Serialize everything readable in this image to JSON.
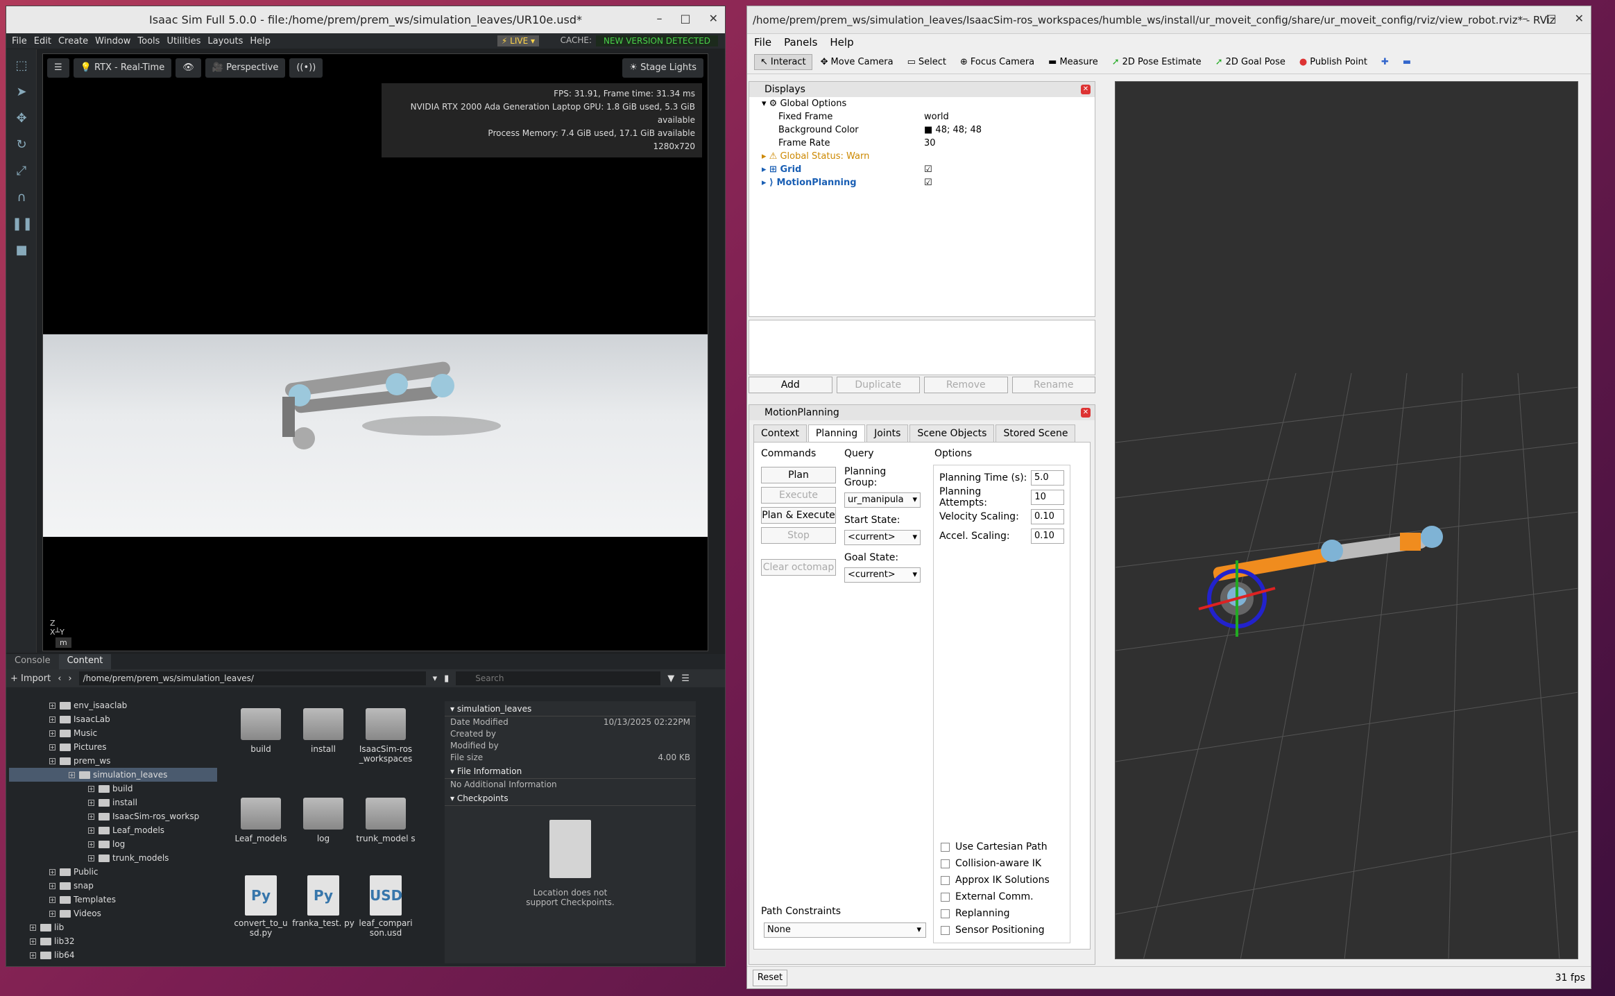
{
  "isaac": {
    "title": "Isaac Sim Full 5.0.0 - file:/home/prem/prem_ws/simulation_leaves/UR10e.usd*",
    "menu": [
      "File",
      "Edit",
      "Create",
      "Window",
      "Tools",
      "Utilities",
      "Layouts",
      "Help"
    ],
    "live": "LIVE",
    "cache": "CACHE:",
    "new_version": "NEW VERSION DETECTED",
    "viewport": {
      "rtx": "RTX - Real-Time",
      "perspective": "Perspective",
      "stage_lights": "Stage Lights",
      "stats": [
        "FPS: 31.91, Frame time: 31.34 ms",
        "NVIDIA RTX 2000 Ada Generation Laptop GPU: 1.8 GiB used, 5.3 GiB available",
        "Process Memory: 7.4 GiB used, 17.1 GiB available",
        "1280x720"
      ],
      "unit": "m",
      "axis_z": "Z",
      "axis_x": "X",
      "axis_y": "Y"
    },
    "bottom": {
      "tab_console": "Console",
      "tab_content": "Content",
      "import": "Import",
      "path": "/home/prem/prem_ws/simulation_leaves/",
      "search": "Search",
      "tree": [
        {
          "label": "env_isaaclab",
          "indent": 1
        },
        {
          "label": "IsaacLab",
          "indent": 1
        },
        {
          "label": "Music",
          "indent": 1
        },
        {
          "label": "Pictures",
          "indent": 1
        },
        {
          "label": "prem_ws",
          "indent": 1
        },
        {
          "label": "simulation_leaves",
          "indent": 2,
          "sel": true
        },
        {
          "label": "build",
          "indent": 3
        },
        {
          "label": "install",
          "indent": 3
        },
        {
          "label": "IsaacSim-ros_worksp",
          "indent": 3
        },
        {
          "label": "Leaf_models",
          "indent": 3
        },
        {
          "label": "log",
          "indent": 3
        },
        {
          "label": "trunk_models",
          "indent": 3
        },
        {
          "label": "Public",
          "indent": 1
        },
        {
          "label": "snap",
          "indent": 1
        },
        {
          "label": "Templates",
          "indent": 1
        },
        {
          "label": "Videos",
          "indent": 1
        },
        {
          "label": "lib",
          "indent": 0
        },
        {
          "label": "lib32",
          "indent": 0
        },
        {
          "label": "lib64",
          "indent": 0
        }
      ],
      "grid": [
        {
          "label": "build",
          "type": "folder"
        },
        {
          "label": "install",
          "type": "folder"
        },
        {
          "label": "IsaacSim-ros _workspaces",
          "type": "folder"
        },
        {
          "label": "Leaf_models",
          "type": "folder"
        },
        {
          "label": "log",
          "type": "folder"
        },
        {
          "label": "trunk_model s",
          "type": "folder"
        },
        {
          "label": "convert_to_u sd.py",
          "type": "py"
        },
        {
          "label": "franka_test. py",
          "type": "py"
        },
        {
          "label": "leaf_compari son.usd",
          "type": "usd"
        }
      ],
      "info": {
        "name": "simulation_leaves",
        "date_label": "Date Modified",
        "date": "10/13/2025 02:22PM",
        "created": "Created by",
        "modified": "Modified by",
        "size_label": "File size",
        "size": "4.00 KB",
        "file_info": "File Information",
        "no_info": "No Additional Information",
        "checkpoints": "Checkpoints",
        "ckp_msg1": "Location does not",
        "ckp_msg2": "support Checkpoints."
      }
    }
  },
  "rviz": {
    "title": "/home/prem/prem_ws/simulation_leaves/IsaacSim-ros_workspaces/humble_ws/install/ur_moveit_config/share/ur_moveit_config/rviz/view_robot.rviz* - RViz",
    "menu": [
      "File",
      "Panels",
      "Help"
    ],
    "tools": [
      "Interact",
      "Move Camera",
      "Select",
      "Focus Camera",
      "Measure",
      "2D Pose Estimate",
      "2D Goal Pose",
      "Publish Point"
    ],
    "displays": {
      "title": "Displays",
      "global_options": "Global Options",
      "fixed_frame": "Fixed Frame",
      "fixed_frame_v": "world",
      "bg": "Background Color",
      "bg_v": "48; 48; 48",
      "frame_rate": "Frame Rate",
      "frame_rate_v": "30",
      "status": "Global Status: Warn",
      "grid": "Grid",
      "mp": "MotionPlanning"
    },
    "buttons": [
      "Add",
      "Duplicate",
      "Remove",
      "Rename"
    ],
    "mp": {
      "title": "MotionPlanning",
      "tabs": [
        "Context",
        "Planning",
        "Joints",
        "Scene Objects",
        "Stored Scene"
      ],
      "commands": "Commands",
      "query": "Query",
      "options": "Options",
      "plan": "Plan",
      "execute": "Execute",
      "plan_exec": "Plan & Execute",
      "stop": "Stop",
      "clear": "Clear octomap",
      "pg": "Planning Group:",
      "pg_v": "ur_manipula",
      "ss": "Start State:",
      "ss_v": "<current>",
      "gs": "Goal State:",
      "gs_v": "<current>",
      "pt": "Planning Time (s):",
      "pt_v": "5.0",
      "pa": "Planning Attempts:",
      "pa_v": "10",
      "vs": "Velocity Scaling:",
      "vs_v": "0.10",
      "as": "Accel. Scaling:",
      "as_v": "0.10",
      "checks": [
        "Use Cartesian Path",
        "Collision-aware IK",
        "Approx IK Solutions",
        "External Comm.",
        "Replanning",
        "Sensor Positioning"
      ],
      "path_constraints": "Path Constraints",
      "pc_v": "None"
    },
    "reset": "Reset",
    "fps": "31 fps"
  }
}
